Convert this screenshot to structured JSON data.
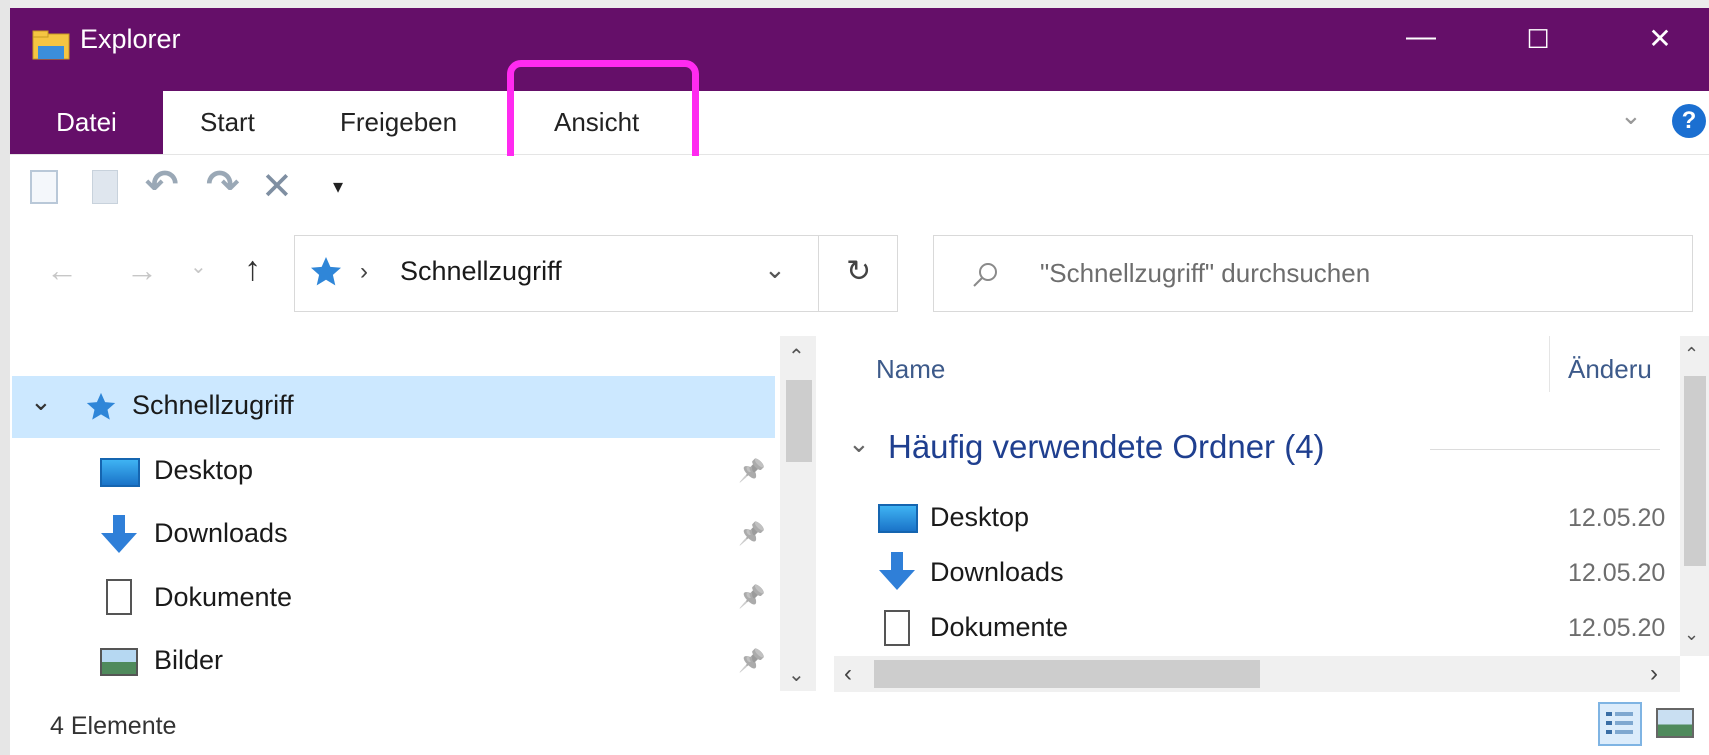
{
  "window": {
    "title": "Explorer",
    "minimize": "—",
    "maximize": "☐",
    "close": "✕"
  },
  "ribbon": {
    "tabs": {
      "file": "Datei",
      "start": "Start",
      "share": "Freigeben",
      "view": "Ansicht"
    },
    "expand": "⌄",
    "help": "?"
  },
  "qat": {
    "undo": "↶",
    "redo": "↷",
    "delete": "✕",
    "customize": "▾"
  },
  "nav": {
    "back": "←",
    "forward": "→",
    "recent": "⌄",
    "up": "↑"
  },
  "address": {
    "separator": "›",
    "location": "Schnellzugriff",
    "dropdown": "⌄",
    "refresh": "↻"
  },
  "search": {
    "placeholder": "\"Schnellzugriff\" durchsuchen"
  },
  "sidebar": {
    "root": {
      "label": "Schnellzugriff",
      "expand": "⌄"
    },
    "items": [
      {
        "label": "Desktop",
        "icon": "desktop-icon",
        "pin": "📌"
      },
      {
        "label": "Downloads",
        "icon": "downloads-icon",
        "pin": "📌"
      },
      {
        "label": "Dokumente",
        "icon": "documents-icon",
        "pin": "📌"
      },
      {
        "label": "Bilder",
        "icon": "pictures-icon",
        "pin": "📌"
      }
    ]
  },
  "content": {
    "columns": {
      "name": "Name",
      "modified": "Änderu"
    },
    "group": {
      "chevron": "⌄",
      "title": "Häufig verwendete Ordner (4)"
    },
    "rows": [
      {
        "name": "Desktop",
        "date": "12.05.20",
        "icon": "desktop-icon"
      },
      {
        "name": "Downloads",
        "date": "12.05.20",
        "icon": "downloads-icon"
      },
      {
        "name": "Dokumente",
        "date": "12.05.20",
        "icon": "documents-icon"
      }
    ]
  },
  "status": {
    "count": "4 Elemente"
  },
  "colors": {
    "titlebar": "#650f69",
    "highlight": "#ff2af0",
    "selection": "#cce8ff",
    "group_title": "#1f3f8f"
  }
}
